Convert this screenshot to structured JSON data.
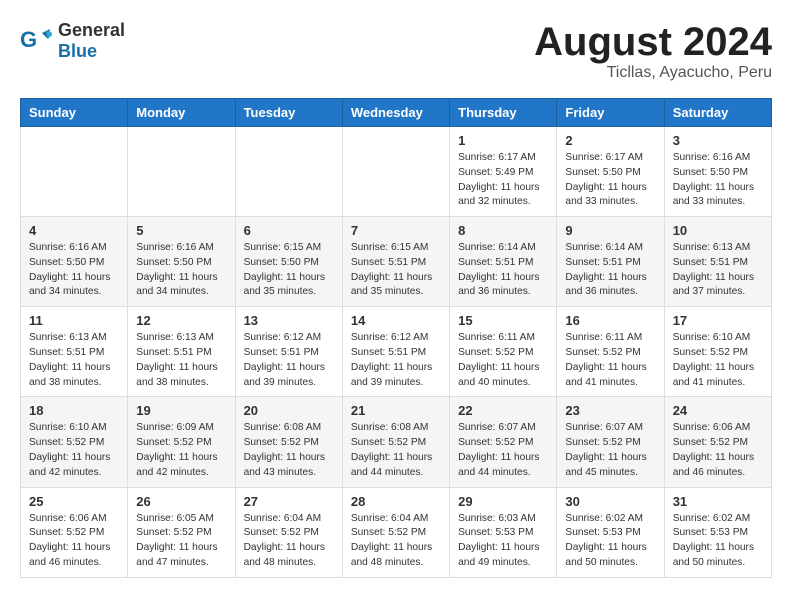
{
  "logo": {
    "general": "General",
    "blue": "Blue"
  },
  "title": "August 2024",
  "subtitle": "Ticllas, Ayacucho, Peru",
  "days": [
    "Sunday",
    "Monday",
    "Tuesday",
    "Wednesday",
    "Thursday",
    "Friday",
    "Saturday"
  ],
  "weeks": [
    [
      {
        "day": "",
        "content": ""
      },
      {
        "day": "",
        "content": ""
      },
      {
        "day": "",
        "content": ""
      },
      {
        "day": "",
        "content": ""
      },
      {
        "day": "1",
        "content": "Sunrise: 6:17 AM\nSunset: 5:49 PM\nDaylight: 11 hours\nand 32 minutes."
      },
      {
        "day": "2",
        "content": "Sunrise: 6:17 AM\nSunset: 5:50 PM\nDaylight: 11 hours\nand 33 minutes."
      },
      {
        "day": "3",
        "content": "Sunrise: 6:16 AM\nSunset: 5:50 PM\nDaylight: 11 hours\nand 33 minutes."
      }
    ],
    [
      {
        "day": "4",
        "content": "Sunrise: 6:16 AM\nSunset: 5:50 PM\nDaylight: 11 hours\nand 34 minutes."
      },
      {
        "day": "5",
        "content": "Sunrise: 6:16 AM\nSunset: 5:50 PM\nDaylight: 11 hours\nand 34 minutes."
      },
      {
        "day": "6",
        "content": "Sunrise: 6:15 AM\nSunset: 5:50 PM\nDaylight: 11 hours\nand 35 minutes."
      },
      {
        "day": "7",
        "content": "Sunrise: 6:15 AM\nSunset: 5:51 PM\nDaylight: 11 hours\nand 35 minutes."
      },
      {
        "day": "8",
        "content": "Sunrise: 6:14 AM\nSunset: 5:51 PM\nDaylight: 11 hours\nand 36 minutes."
      },
      {
        "day": "9",
        "content": "Sunrise: 6:14 AM\nSunset: 5:51 PM\nDaylight: 11 hours\nand 36 minutes."
      },
      {
        "day": "10",
        "content": "Sunrise: 6:13 AM\nSunset: 5:51 PM\nDaylight: 11 hours\nand 37 minutes."
      }
    ],
    [
      {
        "day": "11",
        "content": "Sunrise: 6:13 AM\nSunset: 5:51 PM\nDaylight: 11 hours\nand 38 minutes."
      },
      {
        "day": "12",
        "content": "Sunrise: 6:13 AM\nSunset: 5:51 PM\nDaylight: 11 hours\nand 38 minutes."
      },
      {
        "day": "13",
        "content": "Sunrise: 6:12 AM\nSunset: 5:51 PM\nDaylight: 11 hours\nand 39 minutes."
      },
      {
        "day": "14",
        "content": "Sunrise: 6:12 AM\nSunset: 5:51 PM\nDaylight: 11 hours\nand 39 minutes."
      },
      {
        "day": "15",
        "content": "Sunrise: 6:11 AM\nSunset: 5:52 PM\nDaylight: 11 hours\nand 40 minutes."
      },
      {
        "day": "16",
        "content": "Sunrise: 6:11 AM\nSunset: 5:52 PM\nDaylight: 11 hours\nand 41 minutes."
      },
      {
        "day": "17",
        "content": "Sunrise: 6:10 AM\nSunset: 5:52 PM\nDaylight: 11 hours\nand 41 minutes."
      }
    ],
    [
      {
        "day": "18",
        "content": "Sunrise: 6:10 AM\nSunset: 5:52 PM\nDaylight: 11 hours\nand 42 minutes."
      },
      {
        "day": "19",
        "content": "Sunrise: 6:09 AM\nSunset: 5:52 PM\nDaylight: 11 hours\nand 42 minutes."
      },
      {
        "day": "20",
        "content": "Sunrise: 6:08 AM\nSunset: 5:52 PM\nDaylight: 11 hours\nand 43 minutes."
      },
      {
        "day": "21",
        "content": "Sunrise: 6:08 AM\nSunset: 5:52 PM\nDaylight: 11 hours\nand 44 minutes."
      },
      {
        "day": "22",
        "content": "Sunrise: 6:07 AM\nSunset: 5:52 PM\nDaylight: 11 hours\nand 44 minutes."
      },
      {
        "day": "23",
        "content": "Sunrise: 6:07 AM\nSunset: 5:52 PM\nDaylight: 11 hours\nand 45 minutes."
      },
      {
        "day": "24",
        "content": "Sunrise: 6:06 AM\nSunset: 5:52 PM\nDaylight: 11 hours\nand 46 minutes."
      }
    ],
    [
      {
        "day": "25",
        "content": "Sunrise: 6:06 AM\nSunset: 5:52 PM\nDaylight: 11 hours\nand 46 minutes."
      },
      {
        "day": "26",
        "content": "Sunrise: 6:05 AM\nSunset: 5:52 PM\nDaylight: 11 hours\nand 47 minutes."
      },
      {
        "day": "27",
        "content": "Sunrise: 6:04 AM\nSunset: 5:52 PM\nDaylight: 11 hours\nand 48 minutes."
      },
      {
        "day": "28",
        "content": "Sunrise: 6:04 AM\nSunset: 5:52 PM\nDaylight: 11 hours\nand 48 minutes."
      },
      {
        "day": "29",
        "content": "Sunrise: 6:03 AM\nSunset: 5:53 PM\nDaylight: 11 hours\nand 49 minutes."
      },
      {
        "day": "30",
        "content": "Sunrise: 6:02 AM\nSunset: 5:53 PM\nDaylight: 11 hours\nand 50 minutes."
      },
      {
        "day": "31",
        "content": "Sunrise: 6:02 AM\nSunset: 5:53 PM\nDaylight: 11 hours\nand 50 minutes."
      }
    ]
  ]
}
